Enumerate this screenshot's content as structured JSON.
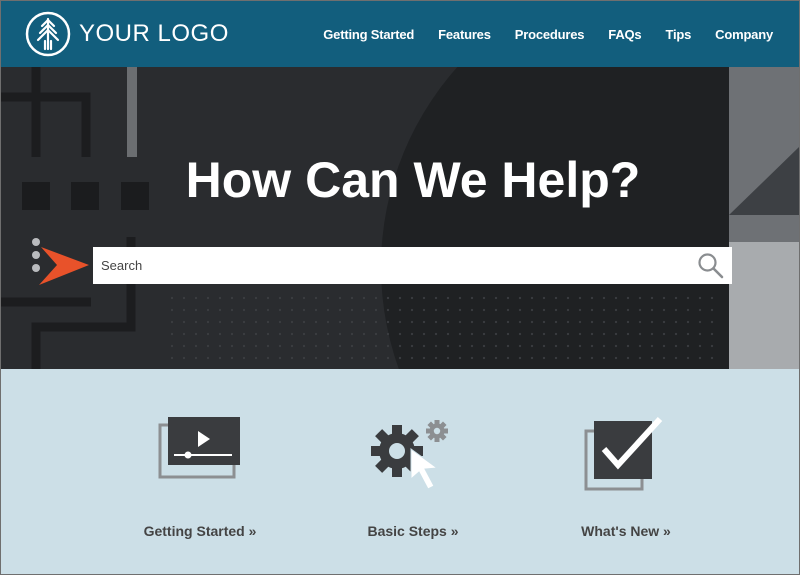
{
  "header": {
    "logo_text": "YOUR LOGO",
    "nav": [
      {
        "label": "Getting Started"
      },
      {
        "label": "Features"
      },
      {
        "label": "Procedures"
      },
      {
        "label": "FAQs"
      },
      {
        "label": "Tips"
      },
      {
        "label": "Company"
      }
    ]
  },
  "hero": {
    "title": "How Can We Help?",
    "search": {
      "placeholder": "Search",
      "value": ""
    }
  },
  "cards": [
    {
      "label": "Getting Started »",
      "icon": "video-player-icon"
    },
    {
      "label": "Basic Steps »",
      "icon": "gear-cursor-icon"
    },
    {
      "label": "What's New »",
      "icon": "checkbox-icon"
    }
  ],
  "colors": {
    "header_bg": "#125e7d",
    "hero_bg": "#27292c",
    "cards_bg": "#ccdfe7",
    "accent": "#e8522a"
  }
}
